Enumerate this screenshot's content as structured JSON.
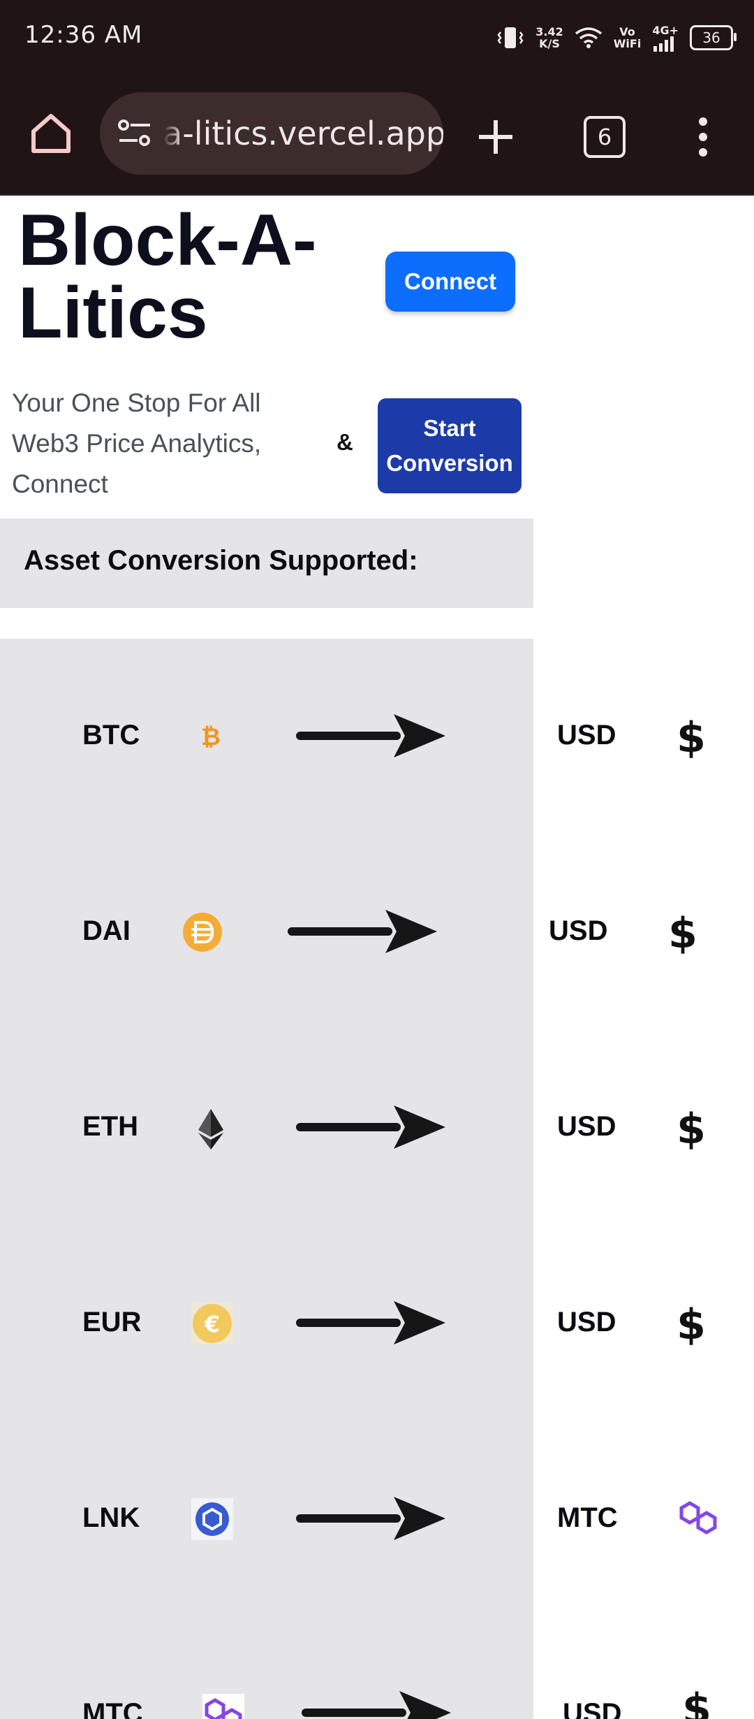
{
  "status_bar": {
    "time": "12:36 AM",
    "net_speed_top": "3.42",
    "net_speed_unit": "K/S",
    "vowifi_top": "Vo",
    "vowifi_bottom": "WiFi",
    "network": "4G+",
    "battery": "36"
  },
  "browser": {
    "url": "a-litics.vercel.app",
    "tab_count": "6"
  },
  "header": {
    "brand_line1": "Block-A-",
    "brand_line2": "Litics",
    "connect_label": "Connect"
  },
  "hero": {
    "tagline": "Your One Stop For All Web3 Price Analytics, Connect",
    "ampersand": "&",
    "start_line1": "Start",
    "start_line2": "Conversion"
  },
  "supported": {
    "heading": "Asset Conversion Supported:"
  },
  "conversions": [
    {
      "from": "BTC",
      "from_icon": "bitcoin-icon",
      "to": "USD",
      "to_icon": "dollar-icon"
    },
    {
      "from": "DAI",
      "from_icon": "dai-icon",
      "to": "USD",
      "to_icon": "dollar-icon"
    },
    {
      "from": "ETH",
      "from_icon": "ethereum-icon",
      "to": "USD",
      "to_icon": "dollar-icon"
    },
    {
      "from": "EUR",
      "from_icon": "euro-icon",
      "to": "USD",
      "to_icon": "dollar-icon"
    },
    {
      "from": "LNK",
      "from_icon": "chainlink-icon",
      "to": "MTC",
      "to_icon": "polygon-icon"
    },
    {
      "from": "MTC",
      "from_icon": "polygon-icon",
      "to": "USD",
      "to_icon": "dollar-icon"
    }
  ],
  "colors": {
    "chrome_bg": "#201414",
    "connect_button": "#0d6efd",
    "start_button": "#1d3ba8",
    "panel_bg": "#e5e5e8",
    "bitcoin": "#f7931a",
    "dai": "#f5ac37",
    "euro": "#f2c95c",
    "chainlink": "#375bd2",
    "polygon": "#8247e5"
  }
}
